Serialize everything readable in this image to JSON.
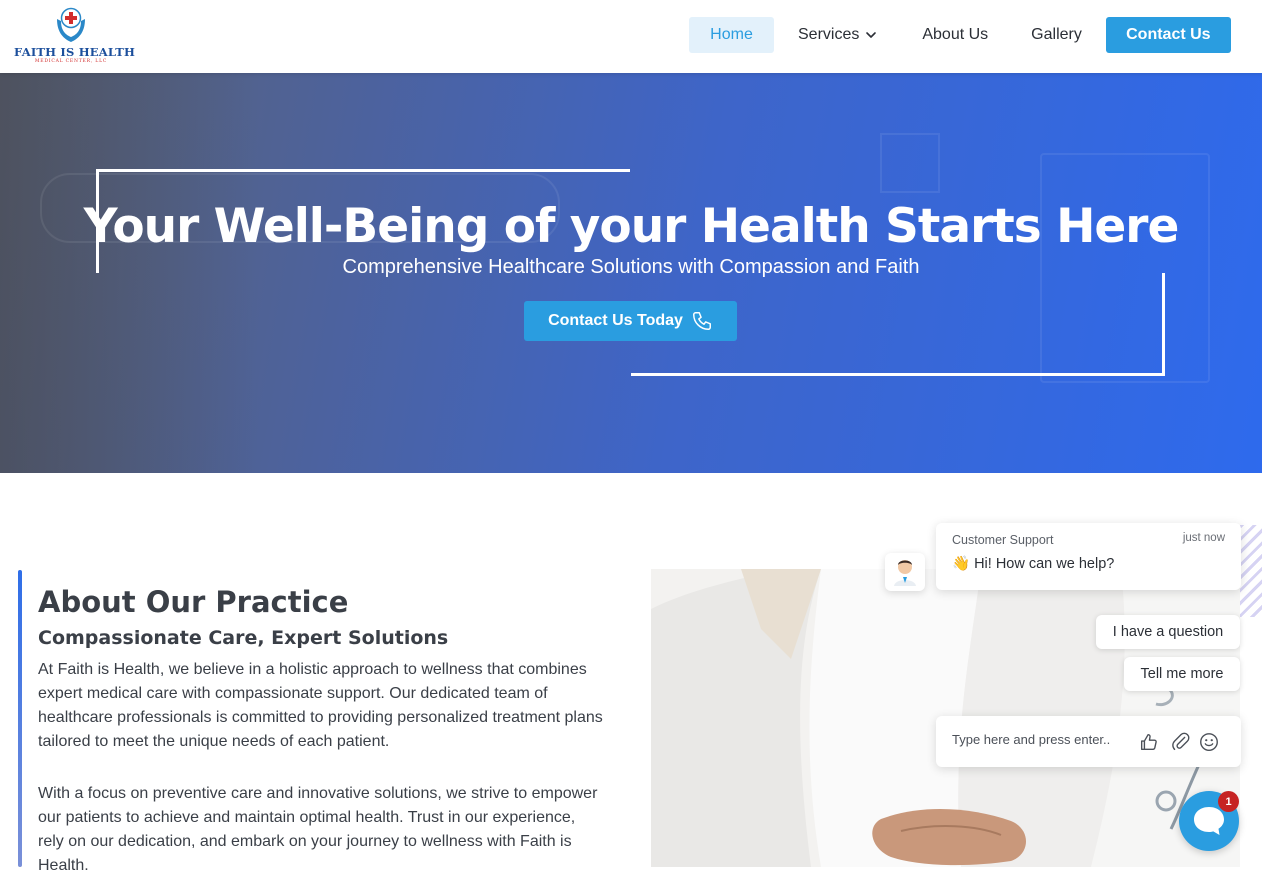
{
  "brand": {
    "name": "FAITH IS HEALTH",
    "tagline": "MEDICAL CENTER, LLC",
    "colors": {
      "primary": "#2a9de0",
      "navy": "#1c4f9c",
      "cross": "#d22d2d"
    }
  },
  "nav": {
    "home": "Home",
    "services": "Services",
    "about": "About Us",
    "gallery": "Gallery",
    "contact": "Contact Us",
    "active": "Home"
  },
  "hero": {
    "title": "Your Well-Being of your Health Starts Here",
    "subtitle": "Comprehensive Healthcare Solutions with Compassion and Faith",
    "cta": "Contact Us Today",
    "cta_icon": "phone-icon"
  },
  "about": {
    "title": "About Our Practice",
    "subtitle": "Compassionate Care, Expert Solutions",
    "paragraph1": "At Faith is Health, we believe in a holistic approach to wellness that combines expert medical care with compassionate support. Our dedicated team of healthcare professionals is committed to providing personalized treatment plans tailored to meet the unique needs of each patient.",
    "paragraph2": "With a focus on preventive care and innovative solutions, we strive to empower our patients to achieve and maintain optimal health. Trust in our experience, rely on our dedication, and embark on your journey to wellness with Faith is Health."
  },
  "chat": {
    "agent": "Customer Support",
    "time": "just now",
    "message": "👋 Hi! How can we help?",
    "options": [
      "I have a question",
      "Tell me more"
    ],
    "input_placeholder": "Type here and press enter..",
    "badge_count": "1",
    "icons": [
      "thumbs-up-icon",
      "paperclip-icon",
      "emoji-icon",
      "chat-icon"
    ]
  }
}
